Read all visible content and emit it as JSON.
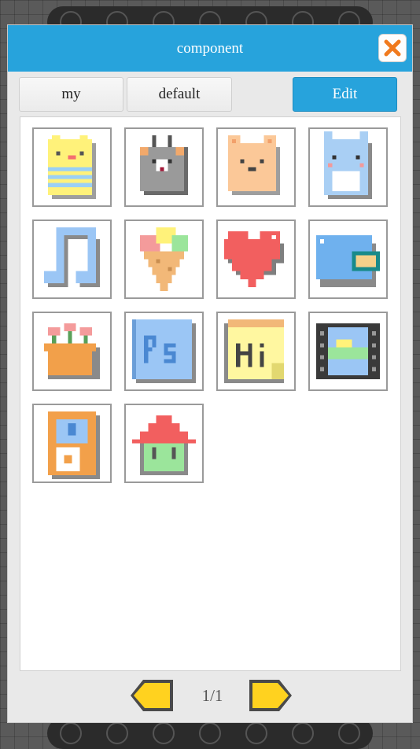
{
  "dialog": {
    "title": "component",
    "close_icon": "close-x-icon",
    "accent_color": "#27a3dc",
    "close_color": "#f07a1e"
  },
  "tabs": [
    {
      "label": "my"
    },
    {
      "label": "default"
    }
  ],
  "edit_label": "Edit",
  "items": [
    {
      "icon": "yellow-chick-icon"
    },
    {
      "icon": "gray-bunny-icon"
    },
    {
      "icon": "orange-cat-icon"
    },
    {
      "icon": "blue-totoro-icon"
    },
    {
      "icon": "music-note-icon"
    },
    {
      "icon": "ice-cream-cone-icon"
    },
    {
      "icon": "red-heart-icon"
    },
    {
      "icon": "blue-wallet-icon"
    },
    {
      "icon": "potted-flowers-icon"
    },
    {
      "icon": "photoshop-ps-icon"
    },
    {
      "icon": "hi-sticky-note-icon"
    },
    {
      "icon": "film-strip-icon"
    },
    {
      "icon": "orange-ipod-icon"
    },
    {
      "icon": "house-icon"
    }
  ],
  "pager": {
    "label": "1/1",
    "prev_icon": "prev-arrow-icon",
    "next_icon": "next-arrow-icon",
    "arrow_color": "#ffd21f"
  }
}
